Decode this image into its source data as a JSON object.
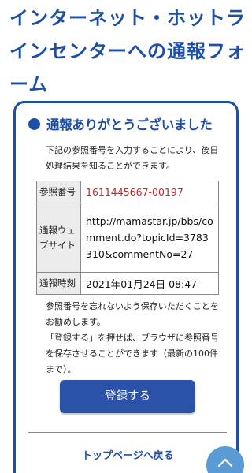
{
  "page": {
    "title": "インターネット・ホットラインセンターへの通報フォーム"
  },
  "card": {
    "heading": "通報ありがとうございました",
    "intro": "下記の参照番号を入力することにより、後日処理結果を知ることができます。",
    "table": {
      "ref_label": "参照番号",
      "ref_value": "1611445667-00197",
      "url_label": "通報ウェブサイト",
      "url_value": "http://mamastar.jp/bbs/comment.do?topicId=3783310&commentNo=27",
      "time_label": "通報時刻",
      "time_value": "2021年01月24日 08:47"
    },
    "note_line1": "参照番号を忘れないよう保存いただくことをお勧めします。",
    "note_line2": "「登録する」を押せば、ブラウザに参照番号を保存させることができます（最新の100件まで）。",
    "register_label": "登録する",
    "top_link": "トップページへ戻る"
  },
  "colors": {
    "primary": "#1e4fa6",
    "button": "#2a52a8",
    "ref_text": "#c0282c",
    "scroll_button": "#5b9bd5"
  },
  "icons": {
    "scroll_top": "chevron-up-icon"
  }
}
